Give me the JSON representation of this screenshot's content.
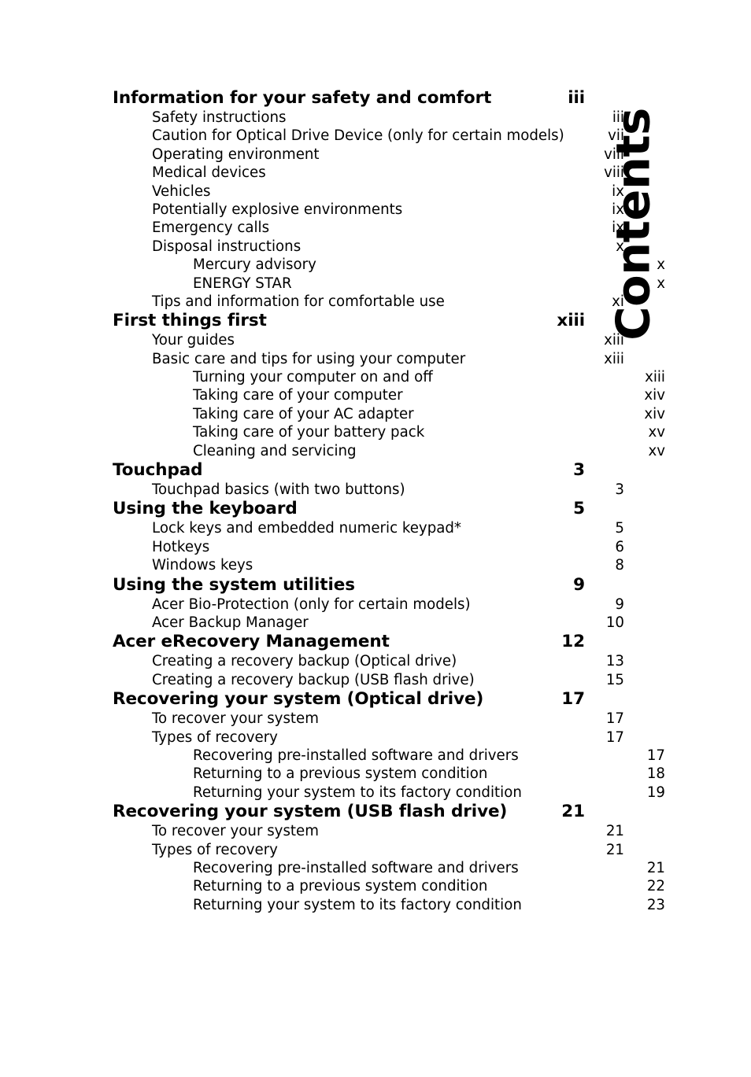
{
  "page": {
    "vertical_title": "Contents"
  },
  "toc": {
    "entries": [
      {
        "level": 1,
        "label": "Information for your safety and comfort",
        "page": "iii"
      },
      {
        "level": 2,
        "label": "Safety instructions",
        "page": "iii"
      },
      {
        "level": 2,
        "label": "Caution for Optical Drive Device (only for certain models)",
        "page": "vii"
      },
      {
        "level": 2,
        "label": "Operating environment",
        "page": "viii"
      },
      {
        "level": 2,
        "label": "Medical devices",
        "page": "viii"
      },
      {
        "level": 2,
        "label": "Vehicles",
        "page": "ix"
      },
      {
        "level": 2,
        "label": "Potentially explosive environments",
        "page": "ix"
      },
      {
        "level": 2,
        "label": "Emergency calls",
        "page": "ix"
      },
      {
        "level": 2,
        "label": "Disposal instructions",
        "page": "x"
      },
      {
        "level": 3,
        "label": "Mercury advisory",
        "page": "x"
      },
      {
        "level": 3,
        "label": "ENERGY STAR",
        "page": "x"
      },
      {
        "level": 2,
        "label": "Tips and information for comfortable use",
        "page": "xi"
      },
      {
        "level": 1,
        "label": "First things first",
        "page": "xiii"
      },
      {
        "level": 2,
        "label": "Your guides",
        "page": "xiii"
      },
      {
        "level": 2,
        "label": "Basic care and tips for using your computer",
        "page": "xiii"
      },
      {
        "level": 3,
        "label": "Turning your computer on and off",
        "page": "xiii"
      },
      {
        "level": 3,
        "label": "Taking care of your computer",
        "page": "xiv"
      },
      {
        "level": 3,
        "label": "Taking care of your AC adapter",
        "page": "xiv"
      },
      {
        "level": 3,
        "label": "Taking care of your battery pack",
        "page": "xv"
      },
      {
        "level": 3,
        "label": "Cleaning and servicing",
        "page": "xv"
      },
      {
        "level": 1,
        "label": "Touchpad",
        "page": "3"
      },
      {
        "level": 2,
        "label": "Touchpad basics (with two buttons)",
        "page": "3"
      },
      {
        "level": 1,
        "label": "Using the keyboard",
        "page": "5"
      },
      {
        "level": 2,
        "label": "Lock keys and embedded numeric keypad*",
        "page": "5"
      },
      {
        "level": 2,
        "label": "Hotkeys",
        "page": "6"
      },
      {
        "level": 2,
        "label": "Windows keys",
        "page": "8"
      },
      {
        "level": 1,
        "label": "Using the system utilities",
        "page": "9"
      },
      {
        "level": 2,
        "label": "Acer Bio-Protection (only for certain models)",
        "page": "9"
      },
      {
        "level": 2,
        "label": "Acer Backup Manager",
        "page": "10"
      },
      {
        "level": 1,
        "label": "Acer eRecovery Management",
        "page": "12"
      },
      {
        "level": 2,
        "label": "Creating a recovery backup (Optical drive)",
        "page": "13"
      },
      {
        "level": 2,
        "label": "Creating a recovery backup (USB flash drive)",
        "page": "15"
      },
      {
        "level": 1,
        "label": "Recovering your system (Optical drive)",
        "page": "17"
      },
      {
        "level": 2,
        "label": "To recover your system",
        "page": "17"
      },
      {
        "level": 2,
        "label": "Types of recovery",
        "page": "17"
      },
      {
        "level": 3,
        "label": "Recovering pre-installed software and drivers",
        "page": "17"
      },
      {
        "level": 3,
        "label": "Returning to a previous system condition",
        "page": "18"
      },
      {
        "level": 3,
        "label": "Returning your system to its factory condition",
        "page": "19"
      },
      {
        "level": 1,
        "label": "Recovering your system (USB flash drive)",
        "page": "21"
      },
      {
        "level": 2,
        "label": "To recover your system",
        "page": "21"
      },
      {
        "level": 2,
        "label": "Types of recovery",
        "page": "21"
      },
      {
        "level": 3,
        "label": "Recovering pre-installed software and drivers",
        "page": "21"
      },
      {
        "level": 3,
        "label": "Returning to a previous system condition",
        "page": "22"
      },
      {
        "level": 3,
        "label": "Returning your system to its factory condition",
        "page": "23"
      }
    ]
  }
}
